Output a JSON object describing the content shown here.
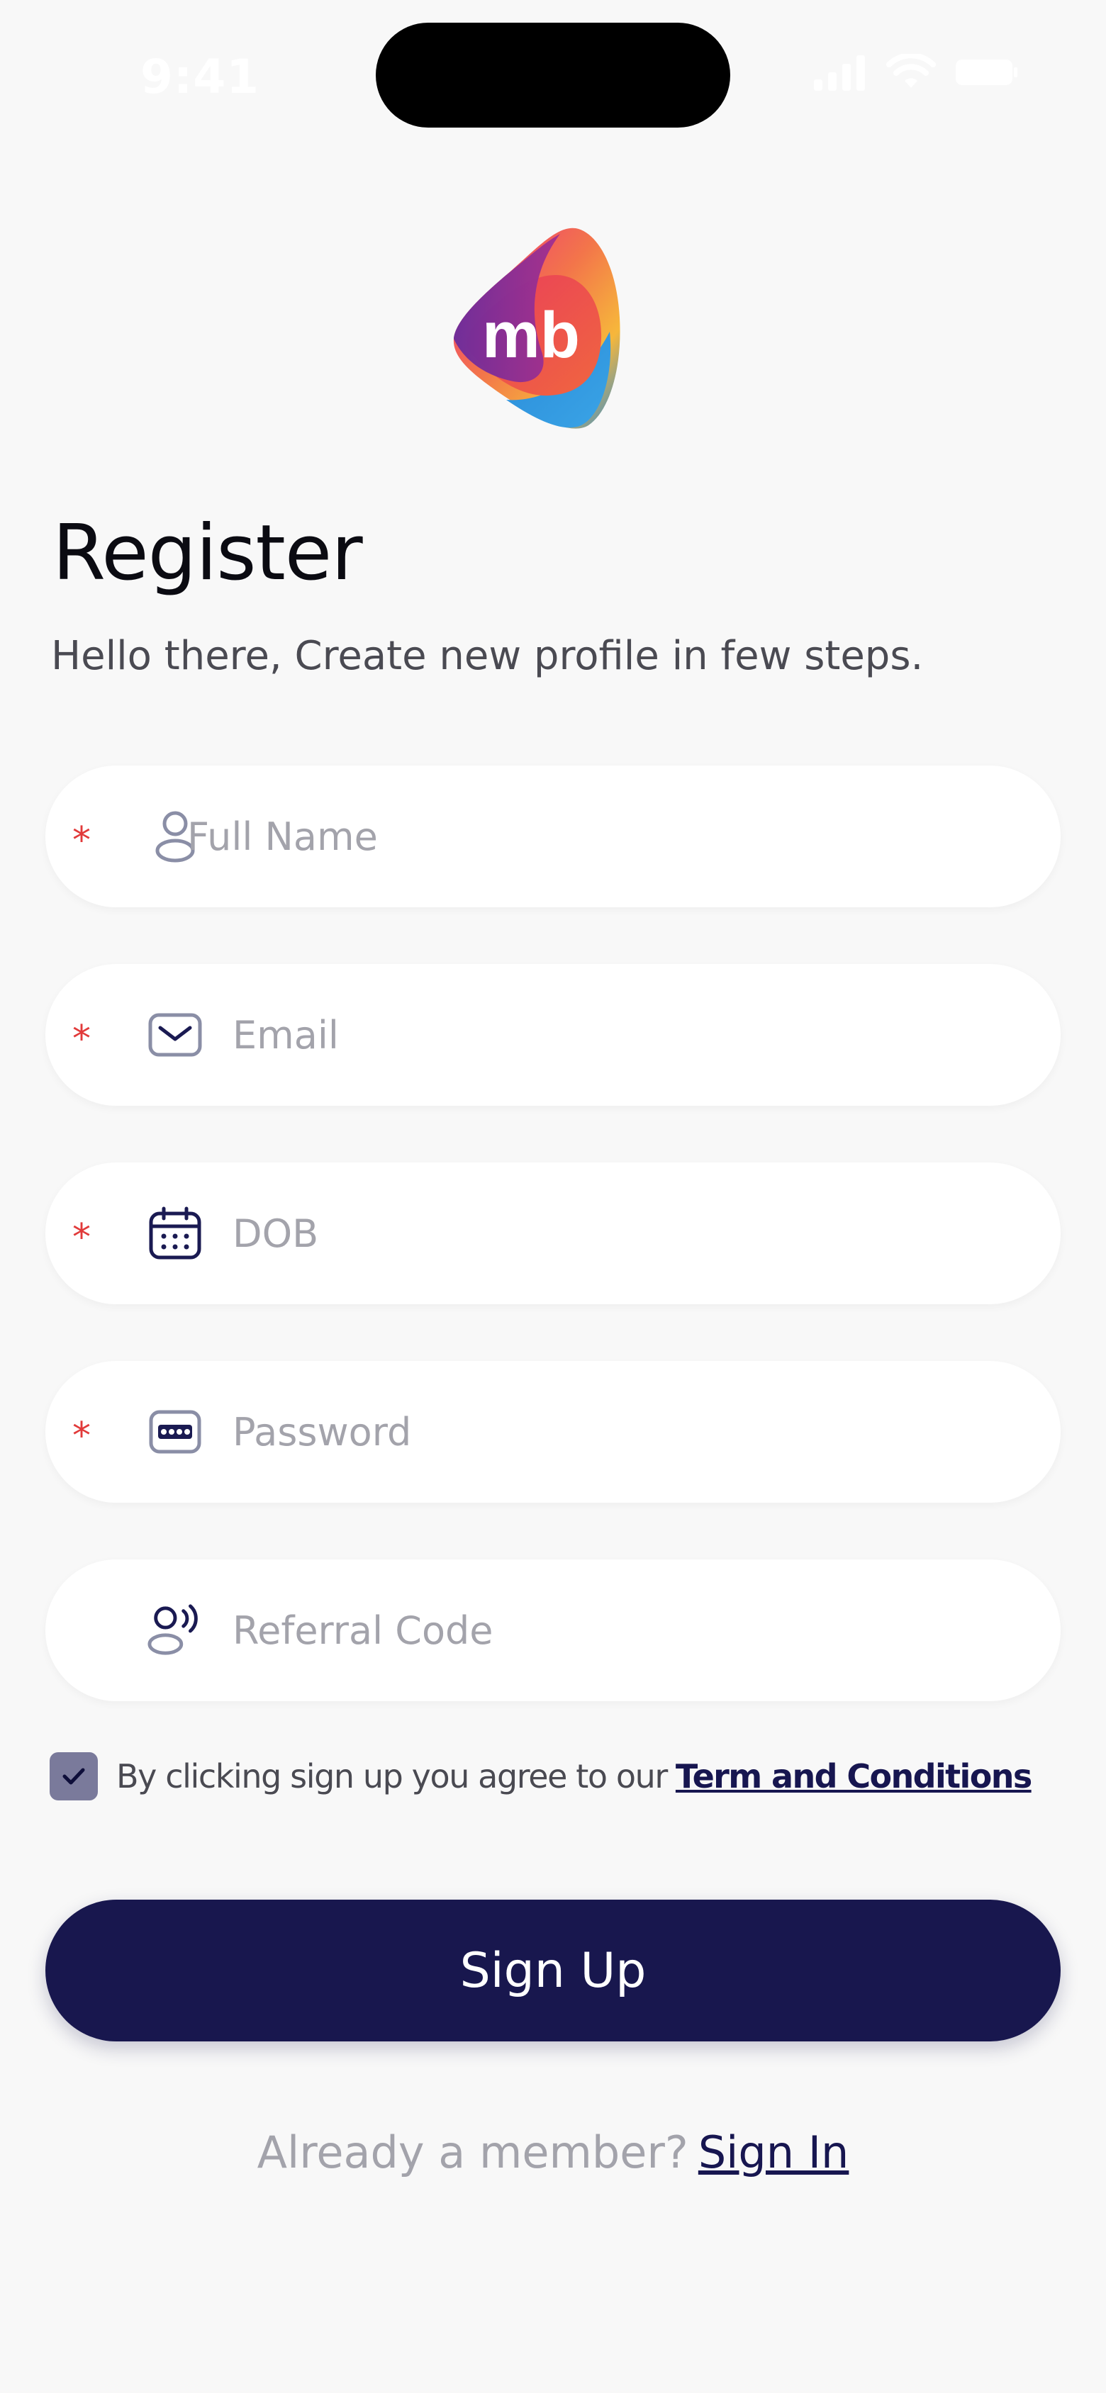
{
  "status_bar": {
    "time": "9:41"
  },
  "header": {
    "title": "Register",
    "subtitle": "Hello there, Create new profile in few steps."
  },
  "form": {
    "full_name": {
      "placeholder": "Full Name",
      "required": true,
      "icon": "user-icon"
    },
    "email": {
      "placeholder": "Email",
      "required": true,
      "icon": "mail-icon"
    },
    "dob": {
      "placeholder": "DOB",
      "required": true,
      "icon": "calendar-icon"
    },
    "password": {
      "placeholder": "Password",
      "required": true,
      "icon": "password-icon"
    },
    "referral": {
      "placeholder": "Referral Code",
      "required": false,
      "icon": "referral-icon"
    },
    "required_marker": "*"
  },
  "agreement": {
    "checked": true,
    "text": "By clicking sign up you agree to our",
    "link": "Term and Conditions"
  },
  "actions": {
    "signup_label": "Sign Up",
    "member_text": "Already a member?",
    "signin_label": "Sign In"
  },
  "colors": {
    "primary": "#18174e",
    "required": "#e13a3a",
    "checkbox": "#7a7a9b",
    "background": "#f8f8f8"
  }
}
